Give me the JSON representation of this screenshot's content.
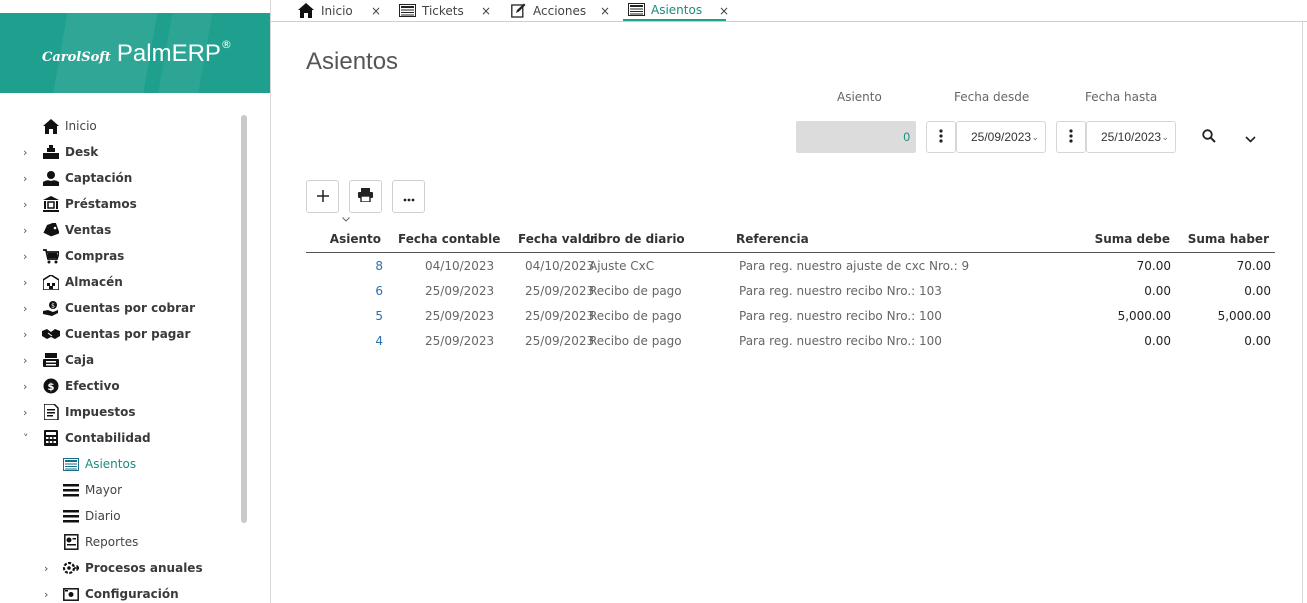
{
  "brand": {
    "small": "CarolSoft",
    "big": "PalmERP",
    "reg": "®"
  },
  "sidebar": {
    "items": [
      {
        "label": "Inicio",
        "icon": "home-icon",
        "chevron": ""
      },
      {
        "label": "Desk",
        "icon": "desk-icon",
        "chevron": "›"
      },
      {
        "label": "Captación",
        "icon": "captacion-icon",
        "chevron": "›"
      },
      {
        "label": "Préstamos",
        "icon": "bank-icon",
        "chevron": "›"
      },
      {
        "label": "Ventas",
        "icon": "tag-icon",
        "chevron": "›"
      },
      {
        "label": "Compras",
        "icon": "cart-icon",
        "chevron": "›"
      },
      {
        "label": "Almacén",
        "icon": "warehouse-icon",
        "chevron": "›"
      },
      {
        "label": "Cuentas por cobrar",
        "icon": "money-hand-icon",
        "chevron": "›"
      },
      {
        "label": "Cuentas por pagar",
        "icon": "handshake-icon",
        "chevron": "›"
      },
      {
        "label": "Caja",
        "icon": "cash-register-icon",
        "chevron": "›"
      },
      {
        "label": "Efectivo",
        "icon": "coins-icon",
        "chevron": "›"
      },
      {
        "label": "Impuestos",
        "icon": "invoice-icon",
        "chevron": "›"
      },
      {
        "label": "Contabilidad",
        "icon": "calculator-icon",
        "chevron": "˅"
      }
    ],
    "subitems": [
      {
        "label": "Asientos",
        "icon": "journal-icon"
      },
      {
        "label": "Mayor",
        "icon": "lines-icon"
      },
      {
        "label": "Diario",
        "icon": "lines-icon"
      },
      {
        "label": "Reportes",
        "icon": "report-icon"
      }
    ],
    "after": [
      {
        "label": "Procesos anuales",
        "icon": "gear-process-icon",
        "chevron": "›"
      },
      {
        "label": "Configuración",
        "icon": "config-icon",
        "chevron": "›"
      }
    ]
  },
  "tabs": [
    {
      "label": "Inicio",
      "icon": "home-icon",
      "close": "×"
    },
    {
      "label": "Tickets",
      "icon": "ticket-icon",
      "close": "×"
    },
    {
      "label": "Acciones",
      "icon": "edit-icon",
      "close": "×"
    },
    {
      "label": "Asientos",
      "icon": "journal-icon",
      "close": "×"
    }
  ],
  "page": {
    "title": "Asientos"
  },
  "filters": {
    "asiento_label": "Asiento",
    "asiento_value": "0",
    "fecha_desde_label": "Fecha desde",
    "fecha_desde": "25/09/2023",
    "fecha_hasta_label": "Fecha hasta",
    "fecha_hasta": "25/10/2023"
  },
  "table": {
    "columns": [
      "Asiento",
      "Fecha contable",
      "Fecha valor",
      "Libro de diario",
      "Referencia",
      "Suma debe",
      "Suma haber"
    ],
    "rows": [
      [
        "8",
        "04/10/2023",
        "04/10/2023",
        "Ajuste CxC",
        "Para reg. nuestro ajuste de cxc Nro.: 9",
        "70.00",
        "70.00"
      ],
      [
        "6",
        "25/09/2023",
        "25/09/2023",
        "Recibo de pago",
        "Para reg. nuestro recibo Nro.: 103",
        "0.00",
        "0.00"
      ],
      [
        "5",
        "25/09/2023",
        "25/09/2023",
        "Recibo de pago",
        "Para reg. nuestro recibo Nro.: 100",
        "5,000.00",
        "5,000.00"
      ],
      [
        "4",
        "25/09/2023",
        "25/09/2023",
        "Recibo de pago",
        "Para reg. nuestro recibo Nro.: 100",
        "0.00",
        "0.00"
      ]
    ]
  },
  "colors": {
    "brand": "#1fa08e",
    "accent": "#1a8b7c",
    "link": "#2a6fb0"
  }
}
